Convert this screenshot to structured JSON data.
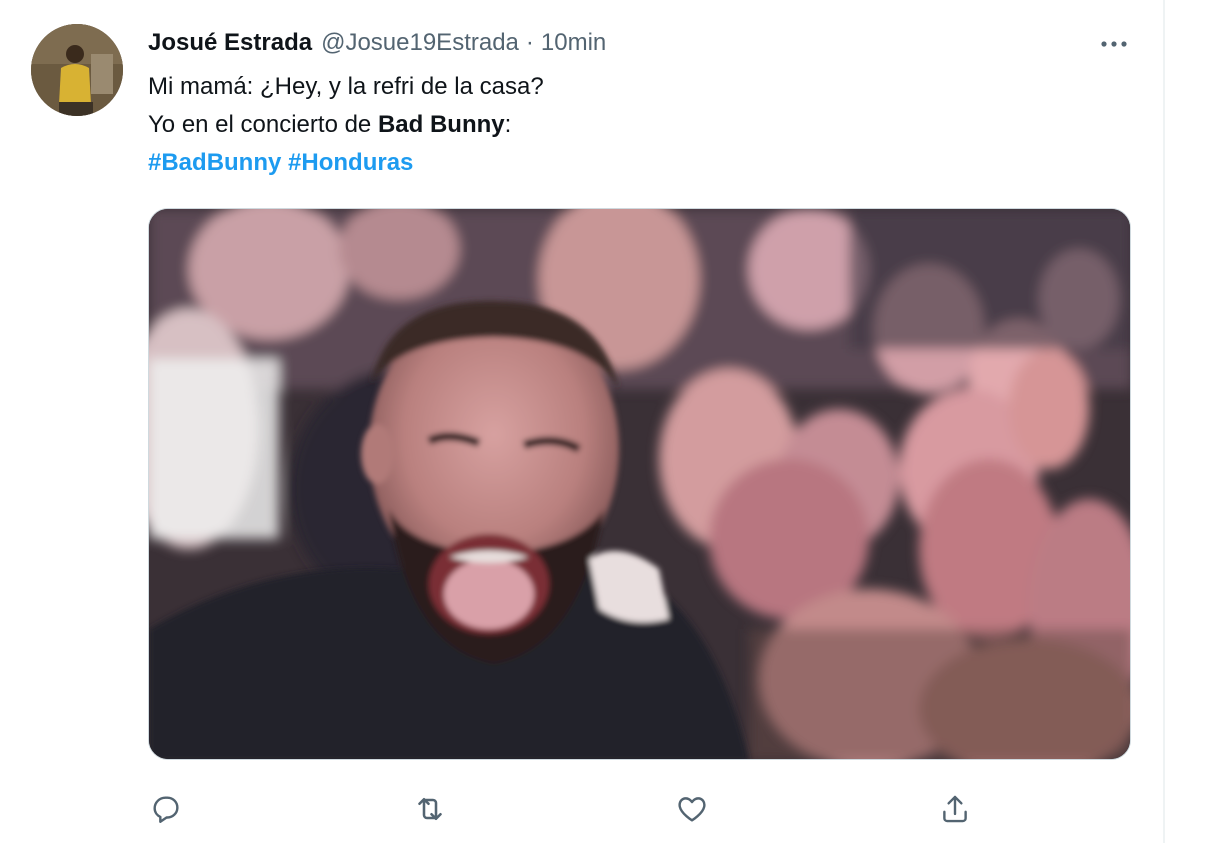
{
  "tweet": {
    "author_name": "Josué Estrada",
    "handle": "@Josue19Estrada",
    "separator": "·",
    "time": "10min",
    "more_icon": "more-horizontal-icon",
    "body": {
      "line1": "Mi mamá: ¿Hey, y la refri de la casa?",
      "line2_prefix": "Yo en el concierto de ",
      "line2_bold": "Bad Bunny",
      "line2_suffix": ":",
      "hashtag1": "#BadBunny",
      "hashtag2": "#Honduras"
    },
    "actions": {
      "reply_icon": "reply-icon",
      "retweet_icon": "retweet-icon",
      "like_icon": "heart-icon",
      "share_icon": "share-icon"
    }
  },
  "colors": {
    "text_primary": "#0f1419",
    "text_secondary": "#536471",
    "hashtag": "#1d9bf0",
    "border": "#cfd9de"
  }
}
